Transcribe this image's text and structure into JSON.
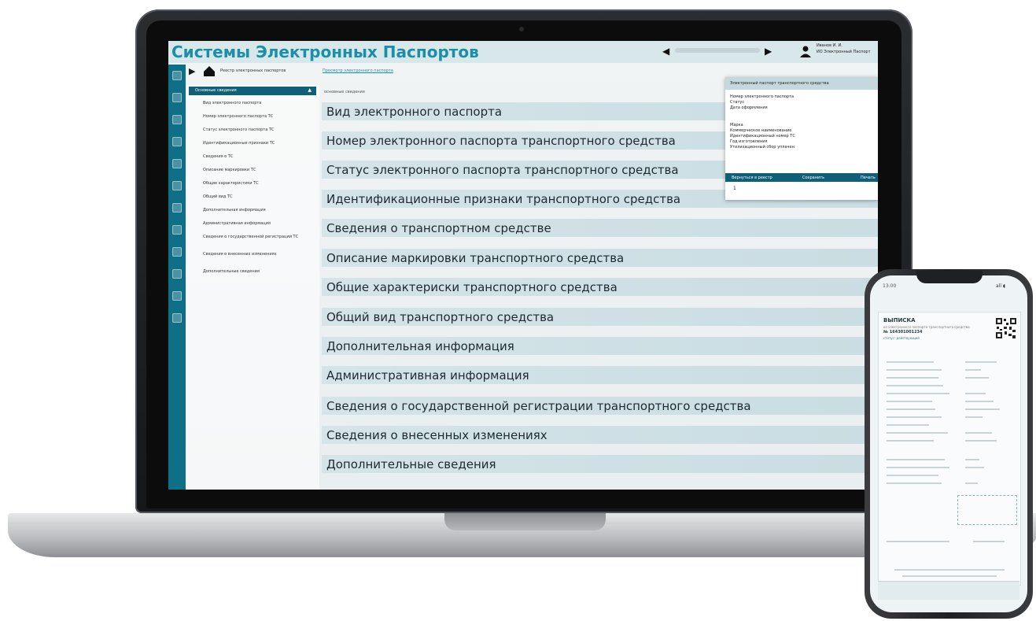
{
  "app": {
    "title": "Системы Электронных Паспортов"
  },
  "header": {
    "user_name": "Иванов И. И.",
    "user_org": "ИО Электронный Паспорт"
  },
  "breadcrumb": {
    "item1": "Реестр электронных паспортов",
    "item2": "Просмотр электронного паспорта"
  },
  "sidebar": {
    "active": "Основные сведения",
    "items": [
      "Вид электронного паспорта",
      "Номер электронного паспорта ТС",
      "Статус электронного паспорта ТС",
      "Идентификационные признаки ТС",
      "Сведения о ТС",
      "Описание маркировки ТС",
      "Общие характеристики ТС",
      "Общий вид ТС",
      "Дополнительная информация",
      "Административная информация",
      "Сведения о государственной регистрации ТС",
      "Сведения о внесенных изменениях",
      "Дополнительные сведения"
    ]
  },
  "main": {
    "caption": "основные сведения",
    "sections": [
      "Вид электронного паспорта",
      "Номер электронного паспорта транспортного средства",
      "Статус электронного паспорта транспортного средства",
      "Идентификационные признаки транспортного средства",
      "Сведения о транспортном средстве",
      "Описание маркировки транспортного средства",
      "Общие характериски транспортного средства",
      "Общий вид транспортного средства",
      "Дополнительная информация",
      "Административная информация",
      "Сведения о государственной регистрации транспортного средства",
      "Сведения о внесенных изменениях",
      "Дополнительные сведения"
    ]
  },
  "popup": {
    "title": "Электронный паспорт транспортного средства",
    "rows": [
      "Номер электронного паспорта",
      "Статус",
      "Дата оформления",
      "Марка",
      "Коммерческое наименование",
      "Идентификационный номер ТС",
      "Год изготовления",
      "Утилизационный сбор уплачен"
    ],
    "buttons": [
      "Вернуться в реестр",
      "Сохранить",
      "Печать"
    ],
    "footer": "1"
  },
  "phone": {
    "time": "13:00",
    "status": "all ◖",
    "doc_title": "ВЫПИСКА",
    "doc_sub": "из электронного паспорта транспортного средства",
    "doc_number": "№ 164301001234",
    "doc_status": "статус: действующий"
  },
  "colors": {
    "accent": "#1c8fa8",
    "rail": "#0f6f86",
    "active_menu": "#0f5f78",
    "section_bg": "#d4e4e8"
  }
}
